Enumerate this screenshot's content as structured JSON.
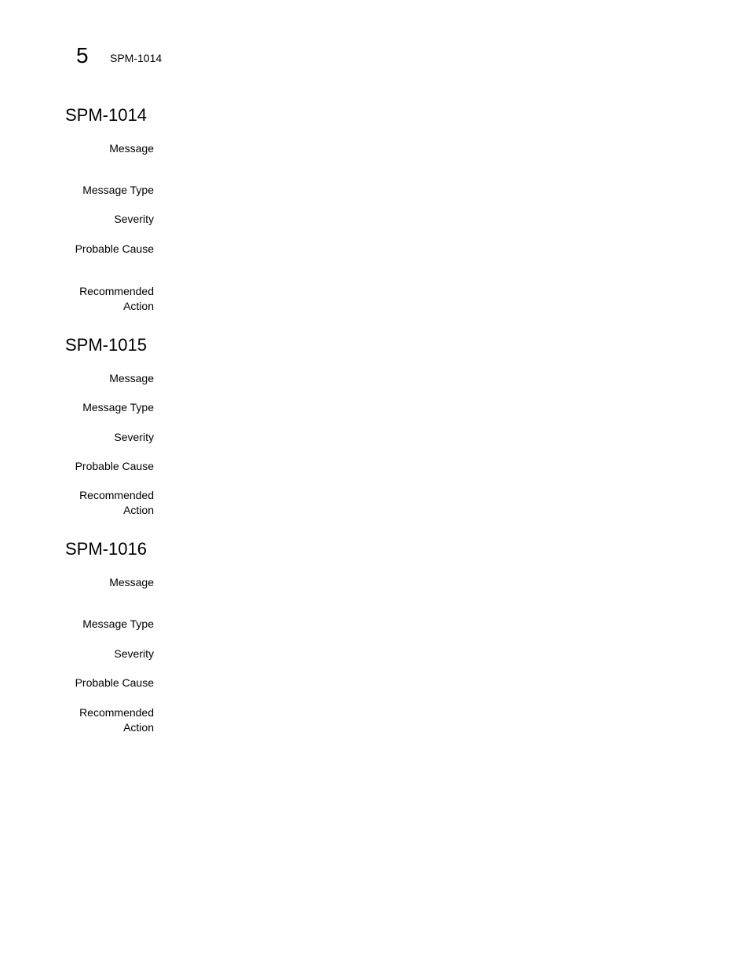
{
  "header": {
    "chapter_number": "5",
    "running_title": "SPM-1014"
  },
  "sections": [
    {
      "title": "SPM-1014",
      "fields": [
        {
          "label": "Message",
          "value": ""
        },
        {
          "label": "Message Type",
          "value": ""
        },
        {
          "label": "Severity",
          "value": ""
        },
        {
          "label": "Probable Cause",
          "value": ""
        },
        {
          "label": "Recommended",
          "label2": "Action",
          "value": ""
        }
      ]
    },
    {
      "title": "SPM-1015",
      "fields": [
        {
          "label": "Message",
          "value": ""
        },
        {
          "label": "Message Type",
          "value": ""
        },
        {
          "label": "Severity",
          "value": ""
        },
        {
          "label": "Probable Cause",
          "value": ""
        },
        {
          "label": "Recommended",
          "label2": "Action",
          "value": ""
        }
      ]
    },
    {
      "title": "SPM-1016",
      "fields": [
        {
          "label": "Message",
          "value": ""
        },
        {
          "label": "Message Type",
          "value": ""
        },
        {
          "label": "Severity",
          "value": ""
        },
        {
          "label": "Probable Cause",
          "value": ""
        },
        {
          "label": "Recommended",
          "label2": "Action",
          "value": ""
        }
      ]
    }
  ]
}
